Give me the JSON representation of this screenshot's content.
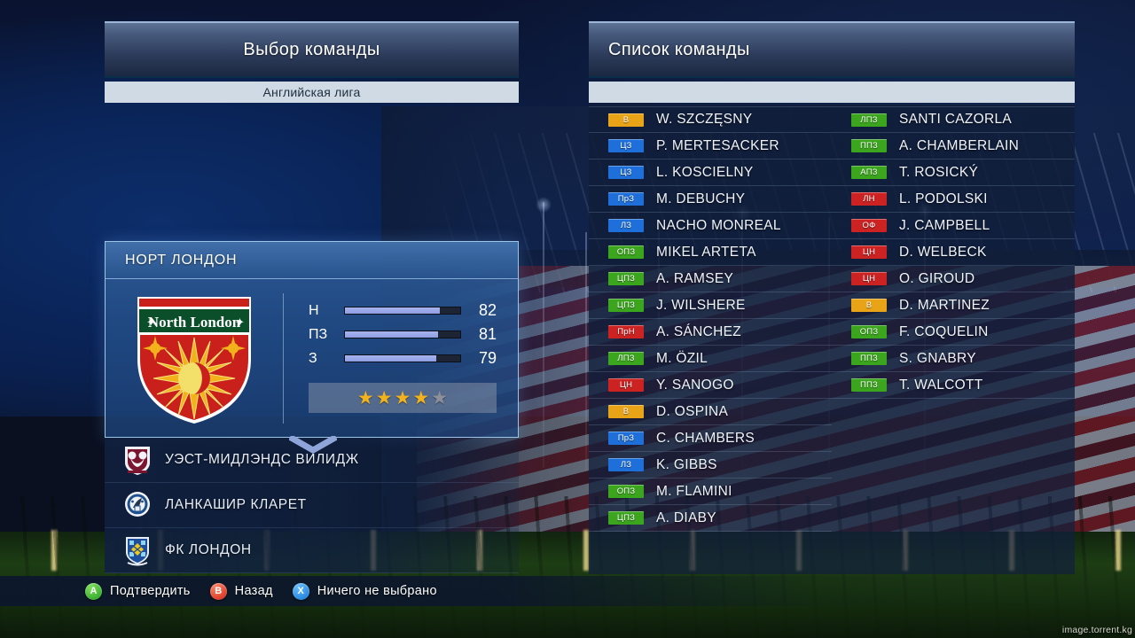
{
  "left": {
    "header_title": "Выбор команды",
    "league": "Английская лига",
    "selected_team": {
      "name": "НОРТ ЛОНДОН",
      "crest_label": "North London",
      "crest_name": "north-london-crest",
      "stats": [
        {
          "label": "Н",
          "value": "82",
          "pct": 82
        },
        {
          "label": "ПЗ",
          "value": "81",
          "pct": 81
        },
        {
          "label": "З",
          "value": "79",
          "pct": 79
        }
      ],
      "stars_filled": 4,
      "stars_total": 5
    },
    "teams": [
      {
        "name": "УЭСТ-МИДЛЭНДС ВИЛИДЖ",
        "crest_name": "west-midlands-village-crest"
      },
      {
        "name": "ЛАНКАШИР КЛАРЕТ",
        "crest_name": "lancashire-claret-crest"
      },
      {
        "name": "ФК ЛОНДОН",
        "crest_name": "fk-london-crest"
      }
    ],
    "scroll_icon": "chevron-down-icon"
  },
  "right": {
    "header_title": "Список команды",
    "squad_left": [
      {
        "pos": "В",
        "pos_color": "#e8a317",
        "name": "W. SZCZĘSNY"
      },
      {
        "pos": "ЦЗ",
        "pos_color": "#1e6fd9",
        "name": "P. MERTESACKER"
      },
      {
        "pos": "ЦЗ",
        "pos_color": "#1e6fd9",
        "name": "L. KOSCIELNY"
      },
      {
        "pos": "ПрЗ",
        "pos_color": "#1e6fd9",
        "name": "M. DEBUCHY"
      },
      {
        "pos": "ЛЗ",
        "pos_color": "#1e6fd9",
        "name": "NACHO MONREAL"
      },
      {
        "pos": "ОПЗ",
        "pos_color": "#3ba51e",
        "name": "MIKEL ARTETA"
      },
      {
        "pos": "ЦПЗ",
        "pos_color": "#3ba51e",
        "name": "A. RAMSEY"
      },
      {
        "pos": "ЦПЗ",
        "pos_color": "#3ba51e",
        "name": "J. WILSHERE"
      },
      {
        "pos": "ПрН",
        "pos_color": "#cc2222",
        "name": "A. SÁNCHEZ"
      },
      {
        "pos": "ЛПЗ",
        "pos_color": "#3ba51e",
        "name": "M. ÖZIL"
      },
      {
        "pos": "ЦН",
        "pos_color": "#cc2222",
        "name": "Y. SANOGO"
      },
      {
        "pos": "В",
        "pos_color": "#e8a317",
        "name": "D. OSPINA"
      },
      {
        "pos": "ПрЗ",
        "pos_color": "#1e6fd9",
        "name": "C. CHAMBERS"
      },
      {
        "pos": "ЛЗ",
        "pos_color": "#1e6fd9",
        "name": "K. GIBBS"
      },
      {
        "pos": "ОПЗ",
        "pos_color": "#3ba51e",
        "name": "M. FLAMINI"
      },
      {
        "pos": "ЦПЗ",
        "pos_color": "#3ba51e",
        "name": "A. DIABY"
      }
    ],
    "squad_right": [
      {
        "pos": "ЛПЗ",
        "pos_color": "#3ba51e",
        "name": "SANTI CAZORLA"
      },
      {
        "pos": "ППЗ",
        "pos_color": "#3ba51e",
        "name": "A. CHAMBERLAIN"
      },
      {
        "pos": "АПЗ",
        "pos_color": "#3ba51e",
        "name": "T. ROSICKÝ"
      },
      {
        "pos": "ЛН",
        "pos_color": "#cc2222",
        "name": "L. PODOLSKI"
      },
      {
        "pos": "ОФ",
        "pos_color": "#cc2222",
        "name": "J. CAMPBELL"
      },
      {
        "pos": "ЦН",
        "pos_color": "#cc2222",
        "name": "D. WELBECK"
      },
      {
        "pos": "ЦН",
        "pos_color": "#cc2222",
        "name": "O. GIROUD"
      },
      {
        "pos": "В",
        "pos_color": "#e8a317",
        "name": "D. MARTINEZ"
      },
      {
        "pos": "ОПЗ",
        "pos_color": "#3ba51e",
        "name": "F. COQUELIN"
      },
      {
        "pos": "ППЗ",
        "pos_color": "#3ba51e",
        "name": "S. GNABRY"
      },
      {
        "pos": "ППЗ",
        "pos_color": "#3ba51e",
        "name": "T. WALCOTT"
      }
    ]
  },
  "footer": {
    "buttons": [
      {
        "key": "A",
        "key_class": "a",
        "label": "Подтвердить"
      },
      {
        "key": "B",
        "key_class": "b",
        "label": "Назад"
      },
      {
        "key": "X",
        "key_class": "x",
        "label": "Ничего не выбрано"
      }
    ]
  },
  "watermark": "image.torrent.kg",
  "colors": {
    "accent": "#9ec4e8",
    "pos_gk": "#e8a317",
    "pos_def": "#1e6fd9",
    "pos_mid": "#3ba51e",
    "pos_fwd": "#cc2222",
    "star_on": "#f2b21c",
    "bar_fill": "#a8b4ee"
  }
}
